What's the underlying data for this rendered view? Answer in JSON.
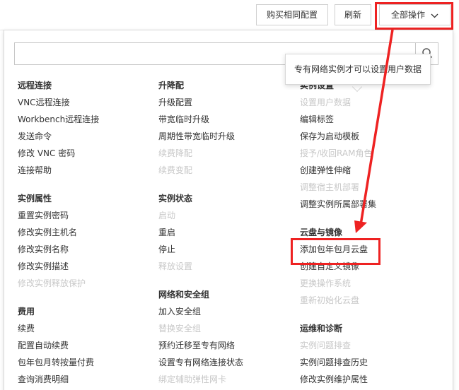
{
  "toolbar": {
    "buy_same_label": "购买相同配置",
    "renew_label": "刷新",
    "all_actions_label": "全部操作"
  },
  "search": {
    "value": "",
    "placeholder": ""
  },
  "tooltip": {
    "text": "专有网络实例才可以设置用户数据"
  },
  "columns": [
    [
      {
        "title": "远程连接",
        "items": [
          {
            "label": "VNC远程连接",
            "enabled": true
          },
          {
            "label": "Workbench远程连接",
            "enabled": true
          },
          {
            "label": "发送命令",
            "enabled": true
          },
          {
            "label": "修改 VNC 密码",
            "enabled": true
          },
          {
            "label": "连接帮助",
            "enabled": true
          }
        ]
      },
      {
        "title": "实例属性",
        "items": [
          {
            "label": "重置实例密码",
            "enabled": true
          },
          {
            "label": "修改实例主机名",
            "enabled": true
          },
          {
            "label": "修改实例名称",
            "enabled": true
          },
          {
            "label": "修改实例描述",
            "enabled": true
          },
          {
            "label": "修改实例释放保护",
            "enabled": false
          }
        ]
      },
      {
        "title": "费用",
        "items": [
          {
            "label": "续费",
            "enabled": true
          },
          {
            "label": "配置自动续费",
            "enabled": true
          },
          {
            "label": "包年包月转按量付费",
            "enabled": true
          },
          {
            "label": "查询消费明细",
            "enabled": true
          }
        ]
      }
    ],
    [
      {
        "title": "升降配",
        "items": [
          {
            "label": "升级配置",
            "enabled": true
          },
          {
            "label": "带宽临时升级",
            "enabled": true
          },
          {
            "label": "周期性带宽临时升级",
            "enabled": true
          },
          {
            "label": "续费降配",
            "enabled": false
          },
          {
            "label": "续费变配",
            "enabled": false
          }
        ]
      },
      {
        "title": "实例状态",
        "items": [
          {
            "label": "启动",
            "enabled": false
          },
          {
            "label": "重启",
            "enabled": true
          },
          {
            "label": "停止",
            "enabled": true
          },
          {
            "label": "释放设置",
            "enabled": false
          }
        ]
      },
      {
        "title": "网络和安全组",
        "items": [
          {
            "label": "加入安全组",
            "enabled": true
          },
          {
            "label": "替换安全组",
            "enabled": false
          },
          {
            "label": "预约迁移至专有网络",
            "enabled": true
          },
          {
            "label": "设置专有网络连接状态",
            "enabled": true
          },
          {
            "label": "绑定辅助弹性网卡",
            "enabled": false
          }
        ]
      }
    ],
    [
      {
        "title": "实例设置",
        "items": [
          {
            "label": "设置用户数据",
            "enabled": false
          },
          {
            "label": "编辑标签",
            "enabled": true
          },
          {
            "label": "保存为启动模板",
            "enabled": true
          },
          {
            "label": "授予/收回RAM角色",
            "enabled": false
          },
          {
            "label": "创建弹性伸缩",
            "enabled": true
          },
          {
            "label": "调整宿主机部署",
            "enabled": false
          },
          {
            "label": "调整实例所属部署集",
            "enabled": true
          }
        ]
      },
      {
        "title": "云盘与镜像",
        "items": [
          {
            "label": "添加包年包月云盘",
            "enabled": true
          },
          {
            "label": "创建自定义镜像",
            "enabled": true
          },
          {
            "label": "更换操作系统",
            "enabled": false
          },
          {
            "label": "重新初始化云盘",
            "enabled": false
          }
        ]
      },
      {
        "title": "运维和诊断",
        "items": [
          {
            "label": "实例问题排查",
            "enabled": false
          },
          {
            "label": "实例问题排查历史",
            "enabled": true
          },
          {
            "label": "修改实例维护属性",
            "enabled": true
          }
        ]
      }
    ]
  ],
  "colors": {
    "highlight": "#ee2222",
    "disabled_text": "#c8c8c8",
    "text": "#333333"
  }
}
